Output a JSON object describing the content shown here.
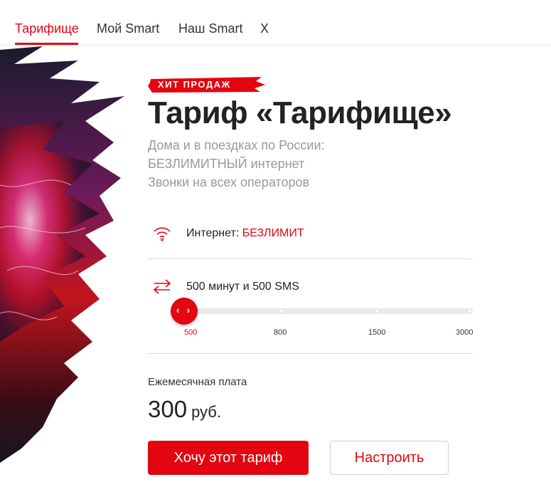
{
  "tabs": [
    {
      "label": "Тарифище",
      "active": true
    },
    {
      "label": "Мой Smart",
      "active": false
    },
    {
      "label": "Наш Smart",
      "active": false
    },
    {
      "label": "X",
      "active": false
    }
  ],
  "badge": "ХИТ ПРОДАЖ",
  "title": "Тариф «Тарифище»",
  "description": [
    "Дома и в поездках по России:",
    "БЕЗЛИМИТНЫЙ интернет",
    "Звонки на всех операторов"
  ],
  "internet": {
    "icon": "wifi-icon",
    "label": "Интернет: ",
    "value": "БЕЗЛИМИТ"
  },
  "minutes": {
    "icon": "swap-arrows-icon",
    "label": "500 минут и 500 SMS"
  },
  "slider": {
    "handle_glyph": "‹ ›",
    "options": [
      "500",
      "800",
      "1500",
      "3000"
    ],
    "selected": "500"
  },
  "fee": {
    "label": "Ежемесячная плата",
    "amount": "300",
    "unit": "руб."
  },
  "buttons": {
    "primary": "Хочу этот тариф",
    "secondary": "Настроить"
  },
  "colors": {
    "accent": "#e30611",
    "text": "#222222",
    "muted": "#999999"
  }
}
